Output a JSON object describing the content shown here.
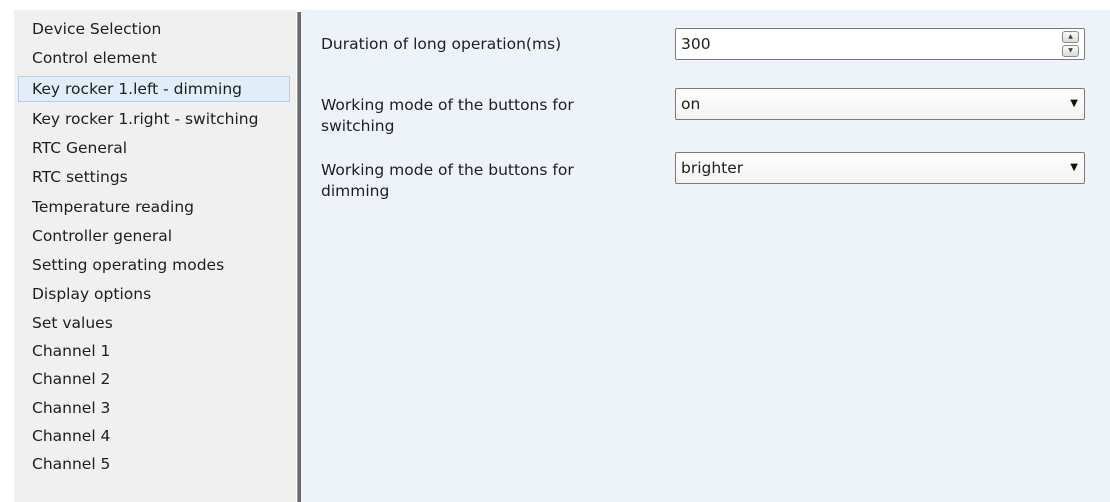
{
  "nav": {
    "items": [
      {
        "label": "Device Selection"
      },
      {
        "label": "Control element"
      },
      {
        "label": "Key rocker 1.left - dimming"
      },
      {
        "label": "Key rocker 1.right - switching"
      },
      {
        "label": "RTC General"
      },
      {
        "label": "RTC settings"
      },
      {
        "label": "Temperature reading"
      },
      {
        "label": "Controller general"
      },
      {
        "label": "Setting operating modes"
      },
      {
        "label": "Display options"
      },
      {
        "label": "Set values"
      },
      {
        "label": "Channel 1"
      },
      {
        "label": "Channel 2"
      },
      {
        "label": "Channel 3"
      },
      {
        "label": "Channel 4"
      },
      {
        "label": "Channel 5"
      }
    ],
    "selected_index": 2
  },
  "params": {
    "long_operation": {
      "label": "Duration of long operation(ms)",
      "value": "300",
      "spin_up_icon": "▲",
      "spin_down_icon": "▼"
    },
    "switching_mode": {
      "label": "Working mode of the buttons for switching",
      "value": "on",
      "arrow_icon": "▼"
    },
    "dimming_mode": {
      "label": "Working mode of the buttons for dimming",
      "value": "brighter",
      "arrow_icon": "▼"
    }
  },
  "colors": {
    "content_background": "#eef3fa",
    "nav_background": "#f0f0f0",
    "selected_background": "#e1edf8"
  }
}
